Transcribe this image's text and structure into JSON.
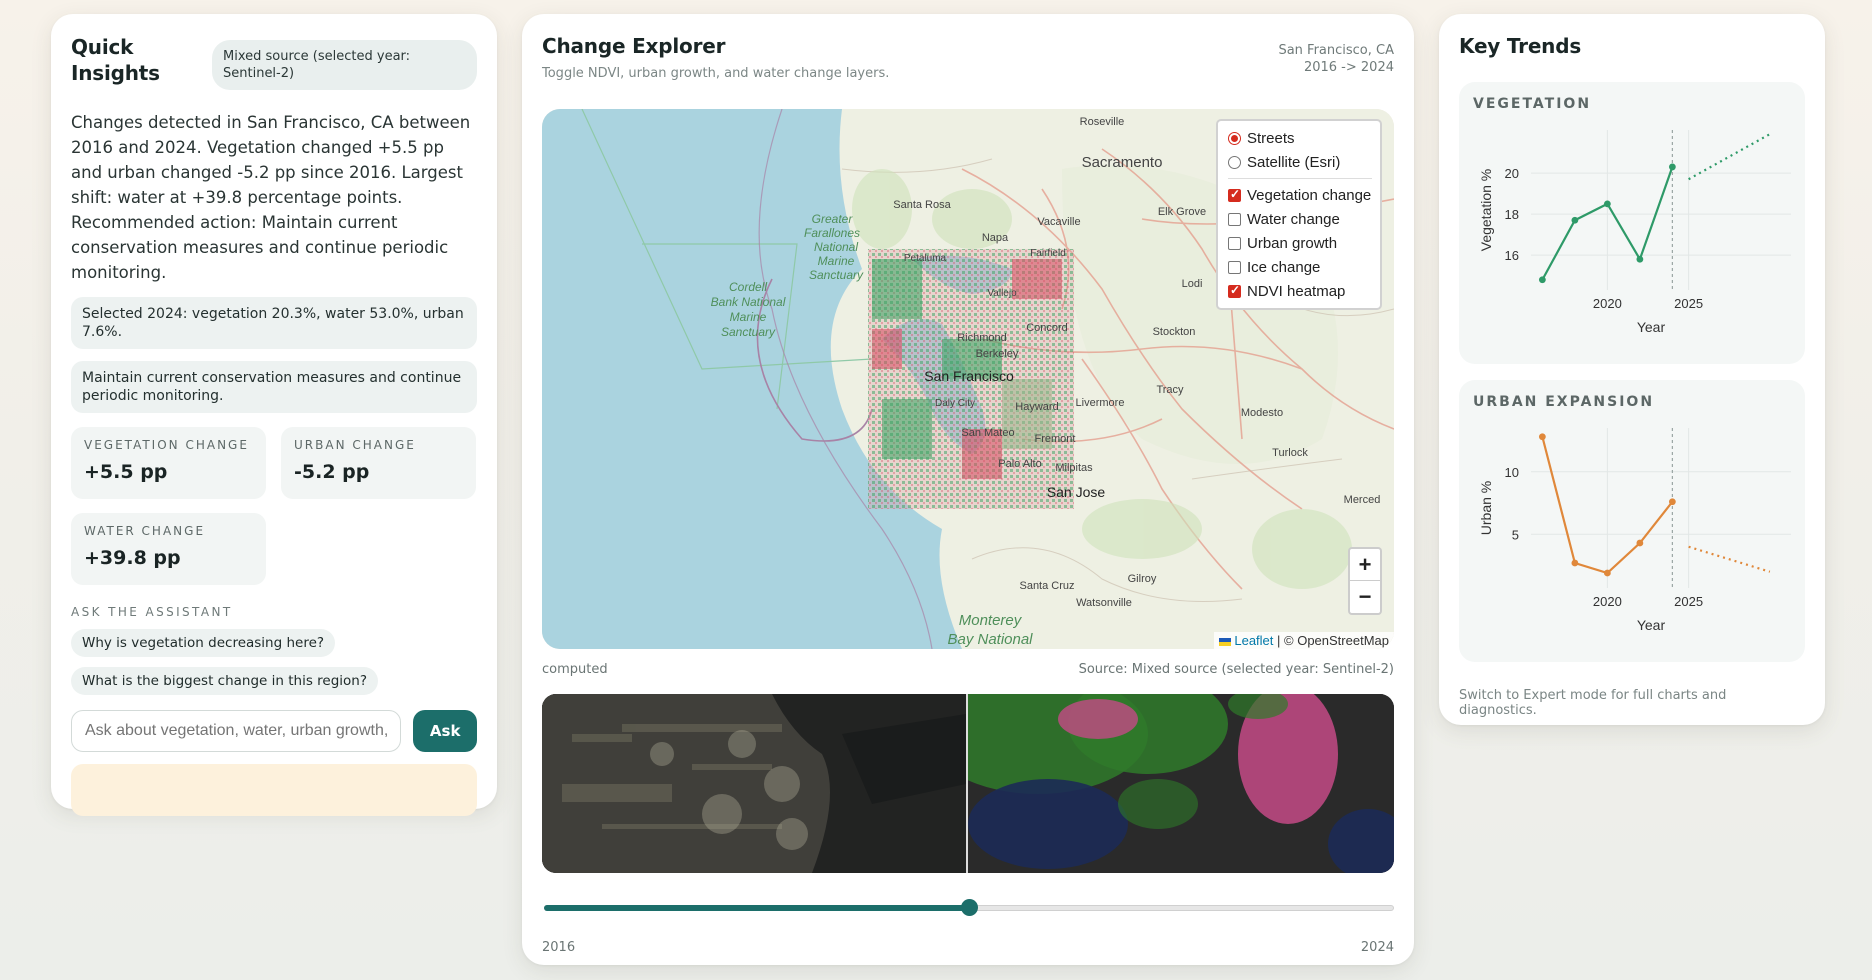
{
  "insights": {
    "title": "Quick Insights",
    "source_pill": "Mixed source (selected year: Sentinel-2)",
    "summary": "Changes detected in San Francisco, CA between 2016 and 2024. Vegetation changed +5.5 pp and urban changed -5.2 pp since 2016. Largest shift: water at +39.8 percentage points. Recommended action: Maintain current conservation measures and continue periodic monitoring.",
    "selected": "Selected 2024: vegetation 20.3%, water 53.0%, urban 7.6%.",
    "recommendation": "Maintain current conservation measures and continue periodic monitoring.",
    "stats": [
      {
        "label": "VEGETATION CHANGE",
        "value": "+5.5 pp"
      },
      {
        "label": "URBAN CHANGE",
        "value": "-5.2 pp"
      },
      {
        "label": "WATER CHANGE",
        "value": "+39.8 pp"
      }
    ],
    "assistant_label": "ASK THE ASSISTANT",
    "suggestions": [
      "Why is vegetation decreasing here?",
      "What is the biggest change in this region?"
    ],
    "input_placeholder": "Ask about vegetation, water, urban growth,",
    "ask_label": "Ask"
  },
  "explorer": {
    "title": "Change Explorer",
    "subtitle": "Toggle NDVI, urban growth, and water change layers.",
    "location": "San Francisco, CA",
    "range": "2016 -> 2024",
    "basemaps": [
      {
        "label": "Streets",
        "selected": true
      },
      {
        "label": "Satellite (Esri)",
        "selected": false
      }
    ],
    "overlays": [
      {
        "label": "Vegetation change",
        "checked": true
      },
      {
        "label": "Water change",
        "checked": false
      },
      {
        "label": "Urban growth",
        "checked": false
      },
      {
        "label": "Ice change",
        "checked": false
      },
      {
        "label": "NDVI heatmap",
        "checked": true
      }
    ],
    "zoom_in": "+",
    "zoom_out": "−",
    "attribution_link": "Leaflet",
    "attribution_rest": "| © OpenStreetMap",
    "map_labels": {
      "sacramento": "Sacramento",
      "san_francisco": "San Francisco",
      "san_jose": "San Jose",
      "santa_rosa": "Santa Rosa",
      "vacaville": "Vacaville",
      "napa": "Napa",
      "fairfield": "Fairfield",
      "petaluma": "Petaluma",
      "vallejo": "Vallejo",
      "concord": "Concord",
      "richmond": "Richmond",
      "berkeley": "Berkeley",
      "stockton": "Stockton",
      "hayward": "Hayward",
      "livermore": "Livermore",
      "tracy": "Tracy",
      "modesto": "Modesto",
      "turlock": "Turlock",
      "merced": "Merced",
      "fremont": "Fremont",
      "san_mateo": "San Mateo",
      "palo_alto": "Palo Alto",
      "milpitas": "Milpitas",
      "daly_city": "Daly City",
      "santa_cruz": "Santa Cruz",
      "gilroy": "Gilroy",
      "watsonville": "Watsonville",
      "elk_grove": "Elk Grove",
      "lodi": "Lodi",
      "roseville": "Roseville",
      "farallones": "Greater Farallones National Marine Sanctuary",
      "cordell": "Cordell Bank National Marine Sanctuary",
      "monterey": "Monterey Bay National"
    },
    "status_left": "computed",
    "status_right": "Source: Mixed source (selected year: Sentinel-2)",
    "slider": {
      "start": "2016",
      "end": "2024",
      "position": 0.5
    }
  },
  "trends": {
    "title": "Key Trends",
    "footer": "Switch to Expert mode for full charts and diagnostics."
  },
  "chart_data": [
    {
      "type": "line",
      "title": "VEGETATION",
      "xlabel": "Year",
      "ylabel": "Vegetation %",
      "x": [
        2016,
        2018,
        2020,
        2022,
        2024
      ],
      "series": [
        {
          "values": [
            14.8,
            17.7,
            18.5,
            15.8,
            20.3
          ],
          "color": "#2e9a68"
        }
      ],
      "forecast": {
        "x": [
          2025,
          2030
        ],
        "values": [
          19.7,
          21.9
        ],
        "style": "dotted"
      },
      "marker_x": 2024,
      "xticks": [
        2020,
        2025
      ],
      "yticks": [
        16,
        18,
        20
      ],
      "xlim": [
        2015.3,
        2031.3
      ],
      "ylim": [
        14.3,
        22.1
      ],
      "grid": true
    },
    {
      "type": "line",
      "title": "URBAN EXPANSION",
      "xlabel": "Year",
      "ylabel": "Urban %",
      "x": [
        2016,
        2018,
        2020,
        2022,
        2024
      ],
      "series": [
        {
          "values": [
            12.8,
            2.7,
            1.9,
            4.3,
            7.6
          ],
          "color": "#e0883a"
        }
      ],
      "forecast": {
        "x": [
          2025,
          2030
        ],
        "values": [
          4.0,
          2.0
        ],
        "style": "dotted"
      },
      "marker_x": 2024,
      "xticks": [
        2020,
        2025
      ],
      "yticks": [
        5,
        10
      ],
      "xlim": [
        2015.3,
        2031.3
      ],
      "ylim": [
        0.7,
        13.5
      ],
      "grid": true
    }
  ]
}
